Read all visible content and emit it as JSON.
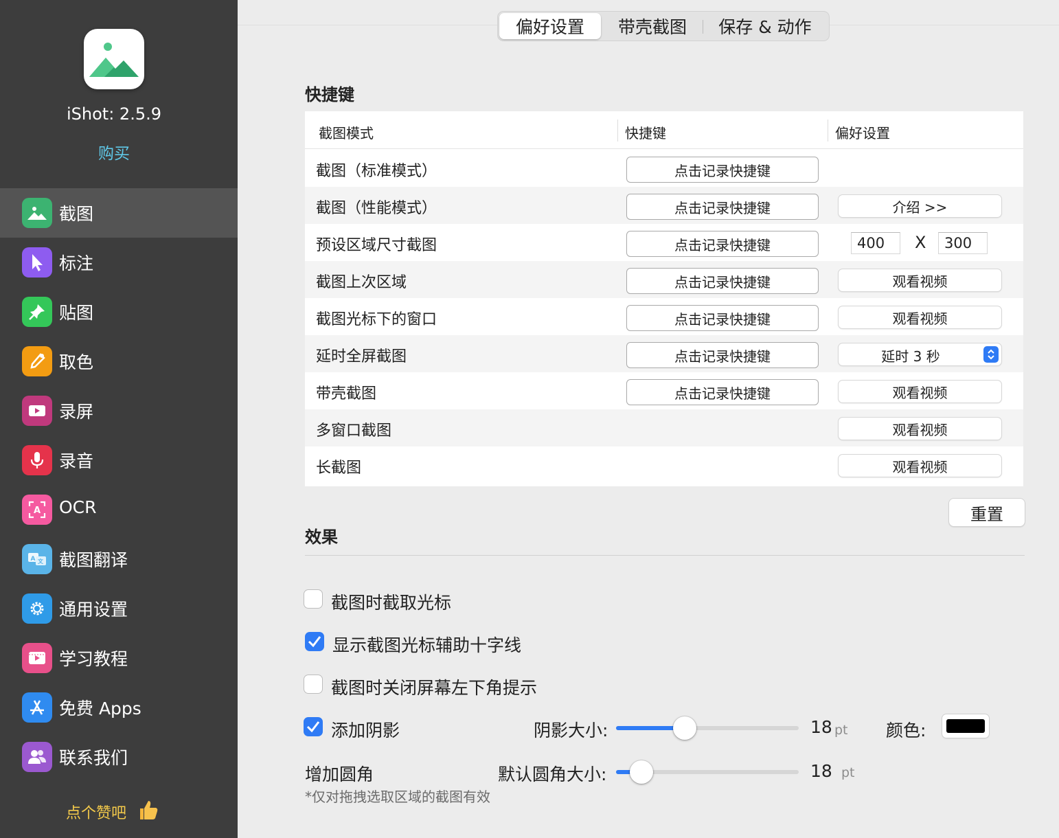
{
  "sidebar": {
    "app_version": "iShot: 2.5.9",
    "buy_label": "购买",
    "items": [
      {
        "label": "截图",
        "icon": "mountain-icon",
        "color": "#3cb371",
        "active": true
      },
      {
        "label": "标注",
        "icon": "cursor-icon",
        "color": "#8e5cf0"
      },
      {
        "label": "贴图",
        "icon": "pin-icon",
        "color": "#34c759"
      },
      {
        "label": "取色",
        "icon": "eyedropper-icon",
        "color": "#f39c12"
      },
      {
        "label": "录屏",
        "icon": "video-icon",
        "color": "#c0397d"
      },
      {
        "label": "录音",
        "icon": "microphone-icon",
        "color": "#e5334b"
      },
      {
        "label": "OCR",
        "icon": "ocr-icon",
        "color": "#f55aa0"
      },
      {
        "label": "截图翻译",
        "icon": "translate-icon",
        "color": "#5ab4e8"
      },
      {
        "label": "通用设置",
        "icon": "gear-icon",
        "color": "#2f9be8"
      },
      {
        "label": "学习教程",
        "icon": "tutorial-icon",
        "color": "#e8508a"
      },
      {
        "label": "免费 Apps",
        "icon": "app-store-icon",
        "color": "#2f8bf0"
      },
      {
        "label": "联系我们",
        "icon": "contacts-icon",
        "color": "#9b59d0"
      }
    ],
    "like_label": "点个赞吧"
  },
  "tabs": [
    {
      "label": "偏好设置",
      "active": true
    },
    {
      "label": "带壳截图",
      "active": false
    },
    {
      "label": "保存 & 动作",
      "active": false
    }
  ],
  "shortcuts": {
    "title": "快捷键",
    "columns": [
      "截图模式",
      "快捷键",
      "偏好设置"
    ],
    "record_label": "点击记录快捷键",
    "rows": [
      {
        "mode": "截图（标准模式）"
      },
      {
        "mode": "截图（性能模式）",
        "pref": "介绍  >>"
      },
      {
        "mode": "预设区域尺寸截图",
        "width": "400",
        "x": "X",
        "height": "300"
      },
      {
        "mode": "截图上次区域",
        "pref": "观看视频"
      },
      {
        "mode": "截图光标下的窗口",
        "pref": "观看视频"
      },
      {
        "mode": "延时全屏截图",
        "select": "延时 3 秒"
      },
      {
        "mode": "带壳截图",
        "pref": "观看视频"
      },
      {
        "mode": "多窗口截图",
        "pref": "观看视频"
      },
      {
        "mode": "长截图",
        "pref": "观看视频"
      }
    ],
    "reset_label": "重置"
  },
  "effects": {
    "title": "效果",
    "capture_cursor": {
      "label": "截图时截取光标",
      "checked": false
    },
    "crosshair": {
      "label": "显示截图光标辅助十字线",
      "checked": true
    },
    "close_hint": {
      "label": "截图时关闭屏幕左下角提示",
      "checked": false
    },
    "shadow": {
      "label": "添加阴影",
      "checked": true,
      "size_label": "阴影大小:",
      "value": "18",
      "unit": "pt",
      "slider_fraction": 0.375,
      "color_label": "颜色:",
      "color": "#000000"
    },
    "corner": {
      "label": "增加圆角",
      "size_label": "默认圆角大小:",
      "value": "18",
      "unit": "pt",
      "slider_fraction": 0.14
    },
    "note": "*仅对拖拽选取区域的截图有效"
  },
  "colors": {
    "accent": "#2f7bf5",
    "sidebar_bg": "#3d3d3d",
    "buy": "#5fc8e8",
    "like": "#f3c94a"
  }
}
